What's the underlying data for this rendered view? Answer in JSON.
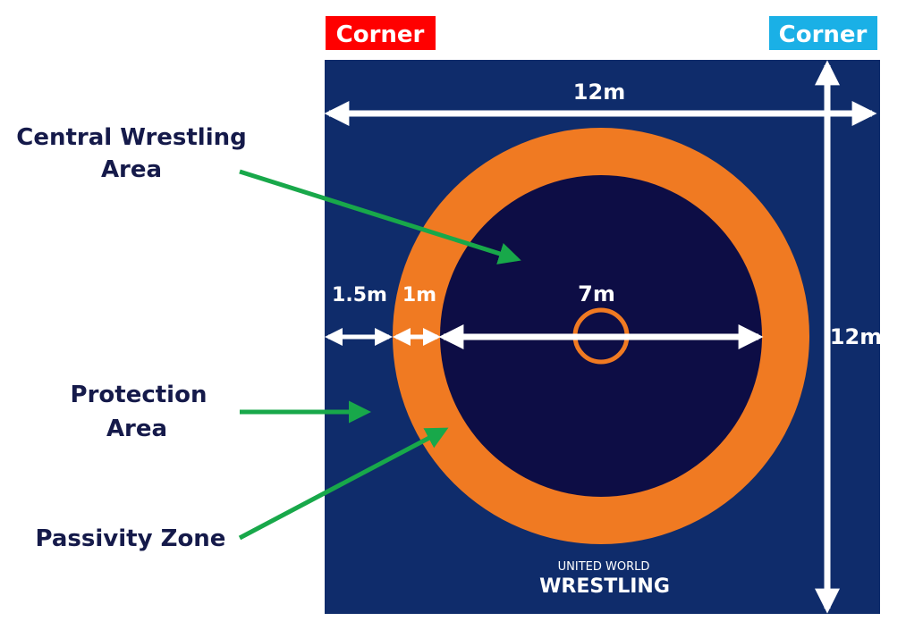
{
  "corners": {
    "red": {
      "label": "Corner",
      "color": "#ff0000"
    },
    "blue": {
      "label": "Corner",
      "color": "#1ab0e6"
    }
  },
  "mat": {
    "protection_color": "#0f2c6b",
    "passivity_color": "#f07a22",
    "central_color": "#0d0d45",
    "width_label": "12m",
    "height_label": "12m",
    "protection_width_label": "1.5m",
    "passivity_width_label": "1m",
    "central_diameter_label": "7m"
  },
  "labels": {
    "central_area_line1": "Central Wrestling",
    "central_area_line2": "Area",
    "protection_area_line1": "Protection",
    "protection_area_line2": "Area",
    "passivity_zone": "Passivity Zone"
  },
  "logo": {
    "line1": "UNITED WORLD",
    "line2": "WRESTLING"
  },
  "pointer_color": "#18a84a"
}
